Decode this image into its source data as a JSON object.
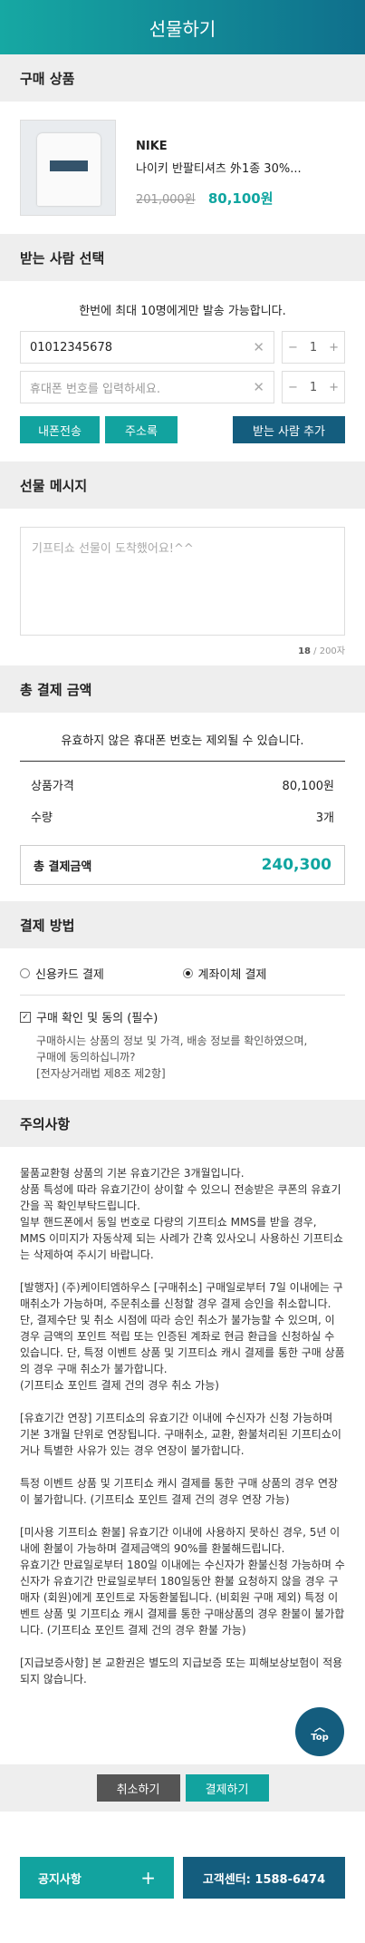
{
  "header": {
    "title": "선물하기"
  },
  "product_section": {
    "title": "구매 상품",
    "brand": "NIKE",
    "name": "나이키 반팔티셔츠 外1종 30%...",
    "original_price": "201,000원",
    "sale_price": "80,100원"
  },
  "recipient_section": {
    "title": "받는 사람 선택",
    "notice": "한번에 최대 10명에게만 발송 가능합니다.",
    "rows": [
      {
        "phone": "01012345678",
        "placeholder": "",
        "qty": "1"
      },
      {
        "phone": "",
        "placeholder": "휴대폰 번호를 입력하세요.",
        "qty": "1"
      }
    ],
    "btn_my_phone": "내폰전송",
    "btn_address": "주소록",
    "btn_add": "받는 사람 추가"
  },
  "message_section": {
    "title": "선물 메시지",
    "placeholder": "기프티쇼 선물이 도착했어요!^^",
    "count": "18",
    "max": " / 200자"
  },
  "payment_total": {
    "title": "총 결제 금액",
    "notice": "유효하지 않은 휴대폰 번호는 제외될 수 있습니다.",
    "price_label": "상품가격",
    "price_value": "80,100원",
    "qty_label": "수량",
    "qty_value": "3개",
    "total_label": "총 결제금액",
    "total_value": "240,300"
  },
  "payment_method": {
    "title": "결제 방법",
    "card": "신용카드 결제",
    "transfer": "계좌이체 결제",
    "agree_title": "구매 확인 및 동의 (필수)",
    "agree_desc_1": "구매하시는 상품의 정보 및 가격, 배송 정보를 확인하였으며,",
    "agree_desc_2": "구매에 동의하십니까?",
    "agree_desc_3": "[전자상거래법 제8조 제2항]"
  },
  "cautions": {
    "title": "주의사항",
    "p1": "물품교환형 상품의 기본 유효기간은 3개월입니다.\n상품 특성에 따라 유효기간이 상이할 수 있으니 전송받은 쿠폰의 유효기간을 꼭 확인부탁드립니다.\n일부 핸드폰에서 동일 번호로 다량의 기프티쇼 MMS를 받을 경우, MMS 이미지가 자동삭제 되는 사례가 간혹 있사오니 사용하신 기프티쇼는 삭제하여 주시기 바랍니다.",
    "p2": "[발행자] (주)케이티엠하우스 [구매취소] 구매일로부터 7일 이내에는 구매취소가 가능하며, 주문취소를 신청할 경우 결제 승인을 취소합니다. 단, 결제수단 및 취소 시점에 따라 승인 취소가 불가능할 수 있으며, 이 경우 금액의 포인트 적립 또는 인증된 계좌로 현금 환급을 신청하실 수 있습니다. 단, 특정 이벤트 상품 및 기프티쇼 캐시 결제를 통한 구매 상품의 경우 구매 취소가 불가합니다.\n(기프티쇼 포인트 결제 건의 경우 취소 가능)",
    "p3": "[유효기간 연장] 기프티쇼의 유효기간 이내에 수신자가 신청 가능하며 기본 3개월 단위로 연장됩니다. 구매취소, 교환, 환불처리된 기프티쇼이거나 특별한 사유가 있는 경우 연장이 불가합니다.",
    "p4": "특정 이벤트 상품 및 기프티쇼 캐시 결제를 통한 구매 상품의 경우 연장이 불가합니다. (기프티쇼 포인트 결제 건의 경우 연장 가능)",
    "p5": "[미사용 기프티쇼 환불] 유효기간 이내에 사용하지 못하신 경우, 5년 이내에 환불이 가능하며 결제금액의 90%를 환불해드립니다.\n유효기간 만료일로부터 180일 이내에는 수신자가 환불신청 가능하며 수신자가 유효기간 만료일로부터 180일동안 환불 요청하지 않을 경우 구매자 (회원)에게 포인트로 자동환불됩니다. (비회원 구매 제외) 특정 이벤트 상품 및 기프티쇼 캐시 결제를 통한 구매상품의 경우 환불이 불가합니다. (기프티쇼 포인트 결제 건의 경우 환불 가능)",
    "p6": "[지급보증사항] 본 교환권은 별도의 지급보증 또는 피해보상보험이 적용되지 않습니다."
  },
  "top_button": {
    "label": "Top"
  },
  "actions": {
    "cancel": "취소하기",
    "pay": "결제하기"
  },
  "footer": {
    "notice": "공지사항",
    "plus": "+",
    "support": "고객센터: 1588-6474"
  },
  "colors": {
    "teal": "#12a39f",
    "navy": "#145d7e"
  }
}
